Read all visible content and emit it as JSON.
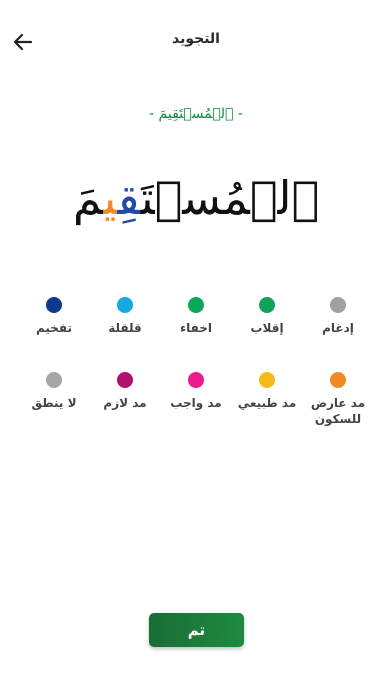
{
  "header": {
    "title": "التجويد",
    "back_icon": "arrow-left-icon"
  },
  "word": {
    "label": "- ٱلۡمُسۡتَقِيمَ -",
    "big_before": "ٱلۡمُسۡتَ",
    "big_blue": "قِ",
    "big_orange": "ي",
    "big_after": "مَ"
  },
  "legend": {
    "row1": [
      {
        "label": "إدغام",
        "color": "#a0a0a0"
      },
      {
        "label": "إقلاب",
        "color": "#14a05a"
      },
      {
        "label": "اخفاء",
        "color": "#0ba85a"
      },
      {
        "label": "قلقلة",
        "color": "#16a8e0"
      },
      {
        "label": "تفخيم",
        "color": "#0d3a8c"
      }
    ],
    "row2": [
      {
        "label": "مد عارض\nللسكون",
        "color": "#f08a24"
      },
      {
        "label": "مد طبيعي",
        "color": "#f6b91a"
      },
      {
        "label": "مد واجب",
        "color": "#ec1a8c"
      },
      {
        "label": "مد لازم",
        "color": "#b0126e"
      },
      {
        "label": "لا ينطق",
        "color": "#a6a6a6"
      }
    ]
  },
  "done_button": {
    "label": "تم"
  }
}
